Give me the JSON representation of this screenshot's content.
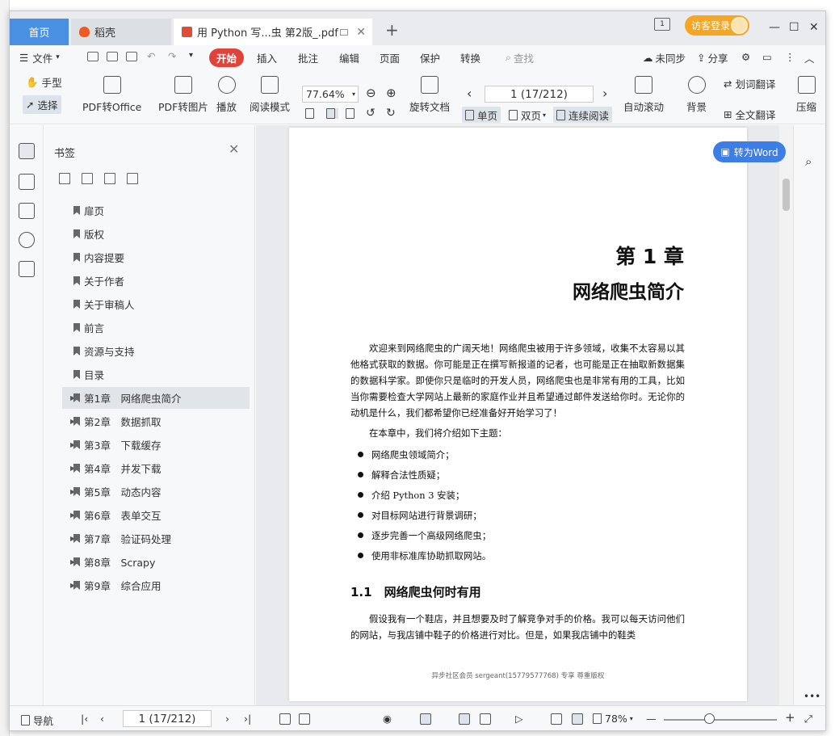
{
  "tabs": {
    "home": "首页",
    "daoke": "稻壳",
    "doc": "用 Python 写...虫 第2版_.pdf",
    "visitor_login": "访客登录"
  },
  "menu": {
    "file": "文件",
    "start": "开始",
    "insert": "插入",
    "annotate": "批注",
    "edit": "编辑",
    "page": "页面",
    "protect": "保护",
    "convert": "转换",
    "search": "查找",
    "unsync": "未同步",
    "share": "分享"
  },
  "ribbon": {
    "hand": "手型",
    "select": "选择",
    "pdf_to_office": "PDF转Office",
    "pdf_to_image": "PDF转图片",
    "play": "播放",
    "read_mode": "阅读模式",
    "zoom": "77.64%",
    "rotate_doc": "旋转文档",
    "page_indicator": "1 (17/212)",
    "single_page": "单页",
    "double_page": "双页",
    "continuous": "连续阅读",
    "auto_scroll": "自动滚动",
    "background": "背景",
    "word_translate": "划词翻译",
    "full_translate": "全文翻译",
    "compress": "压缩"
  },
  "bookmarks": {
    "title": "书签",
    "items": [
      {
        "label": "扉页",
        "expandable": false
      },
      {
        "label": "版权",
        "expandable": false
      },
      {
        "label": "内容提要",
        "expandable": false
      },
      {
        "label": "关于作者",
        "expandable": false
      },
      {
        "label": "关于审稿人",
        "expandable": false
      },
      {
        "label": "前言",
        "expandable": false
      },
      {
        "label": "资源与支持",
        "expandable": false
      },
      {
        "label": "目录",
        "expandable": false
      },
      {
        "label": "第1章　网络爬虫简介",
        "expandable": true,
        "active": true
      },
      {
        "label": "第2章　数据抓取",
        "expandable": true
      },
      {
        "label": "第3章　下载缓存",
        "expandable": true
      },
      {
        "label": "第4章　并发下载",
        "expandable": true
      },
      {
        "label": "第5章　动态内容",
        "expandable": true
      },
      {
        "label": "第6章　表单交互",
        "expandable": true
      },
      {
        "label": "第7章　验证码处理",
        "expandable": true
      },
      {
        "label": "第8章　Scrapy",
        "expandable": true
      },
      {
        "label": "第9章　综合应用",
        "expandable": true
      }
    ]
  },
  "document": {
    "to_word": "转为Word",
    "chapter_number": "第 1 章",
    "chapter_title": "网络爬虫简介",
    "intro_paragraph": "欢迎来到网络爬虫的广阔天地！网络爬虫被用于许多领域，收集不太容易以其他格式获取的数据。你可能是正在撰写新报道的记者，也可能是正在抽取新数据集的数据科学家。即使你只是临时的开发人员，网络爬虫也是非常有用的工具，比如当你需要检查大学网站上最新的家庭作业并且希望通过邮件发送给你时。无论你的动机是什么，我们都希望你已经准备好开始学习了！",
    "topics_intro": "在本章中，我们将介绍如下主题：",
    "bullets": [
      "网络爬虫领域简介；",
      "解释合法性质疑；",
      "介绍 Python 3 安装；",
      "对目标网站进行背景调研；",
      "逐步完善一个高级网络爬虫；",
      "使用非标准库协助抓取网站。"
    ],
    "section_heading": "1.1　网络爬虫何时有用",
    "section_paragraph": "假设我有一个鞋店，并且想要及时了解竞争对手的价格。我可以每天访问他们的网站，与我店铺中鞋子的价格进行对比。但是，如果我店铺中的鞋类",
    "footer_note": "异步社区会员 sergeant(15779577768) 专享 尊重版权"
  },
  "statusbar": {
    "nav": "导航",
    "page_indicator": "1 (17/212)",
    "zoom": "78%"
  }
}
